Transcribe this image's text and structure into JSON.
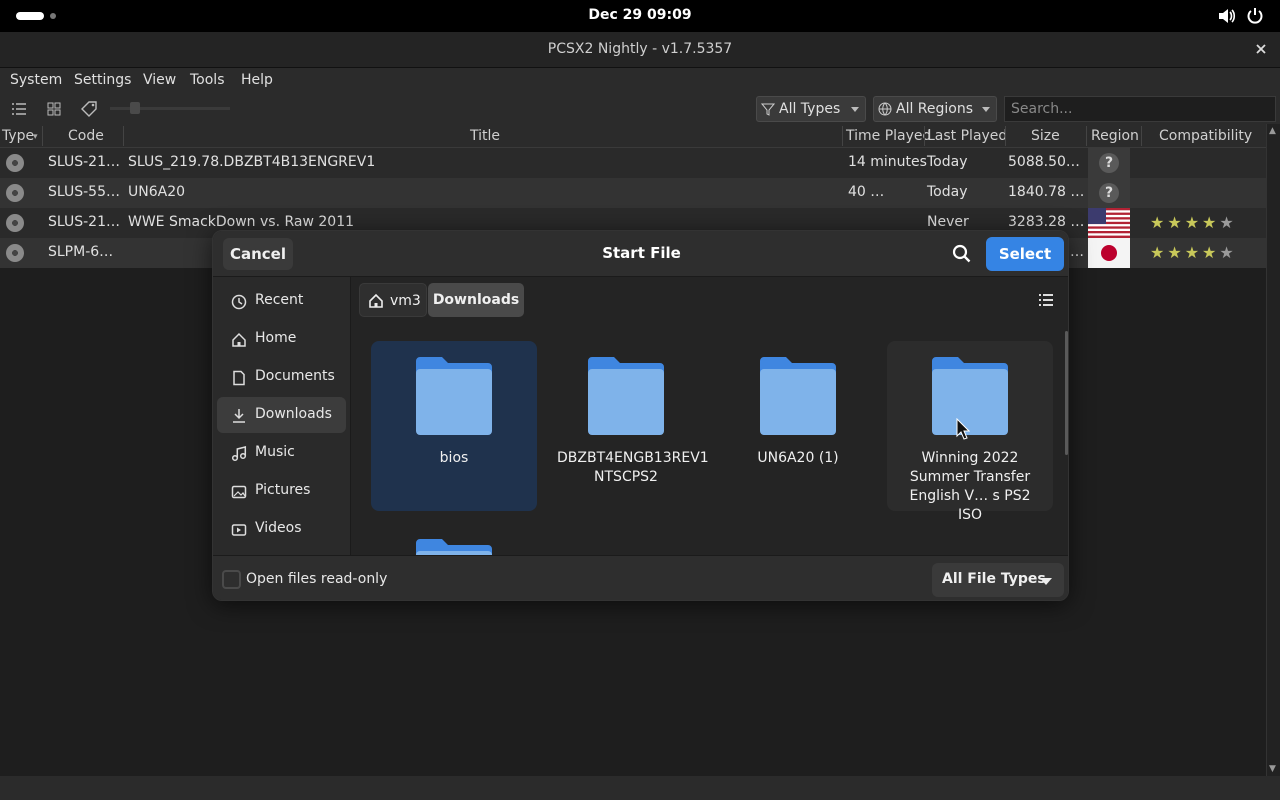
{
  "topbar": {
    "clock": "Dec 29  09:09",
    "icons": [
      "activities-pill",
      "volume-icon",
      "power-icon"
    ]
  },
  "window": {
    "title": "PCSX2 Nightly - v1.7.5357"
  },
  "menu": [
    "System",
    "Settings",
    "View",
    "Tools",
    "Help"
  ],
  "toolbar": {
    "type_filter": "All Types",
    "region_filter": "All Regions",
    "search_placeholder": "Search..."
  },
  "table": {
    "columns": [
      "Type",
      "Code",
      "Title",
      "Time Played",
      "Last Played",
      "Size",
      "Region",
      "Compatibility"
    ],
    "rows": [
      {
        "code": "SLUS-21…",
        "title": "SLUS_219.78.DBZBT4B13ENGREV1",
        "time_played": "14 minutes",
        "last_played": "Today",
        "size": "5088.50…",
        "region": "unknown",
        "stars": 0
      },
      {
        "code": "SLUS-55…",
        "title": "UN6A20",
        "time_played": "40 …",
        "last_played": "Today",
        "size": "1840.78 …",
        "region": "unknown",
        "stars": 0
      },
      {
        "code": "SLUS-21…",
        "title": "WWE SmackDown vs. Raw 2011",
        "time_played": "",
        "last_played": "Never",
        "size": "3283.28 …",
        "region": "usa",
        "stars": 4
      },
      {
        "code": "SLPM-6…",
        "title": "",
        "time_played": "",
        "last_played": "",
        "size": "…",
        "region": "japan",
        "stars": 4
      }
    ]
  },
  "dialog": {
    "title": "Start File",
    "cancel_label": "Cancel",
    "select_label": "Select",
    "sidebar": [
      {
        "label": "Recent",
        "icon": "clock-icon"
      },
      {
        "label": "Home",
        "icon": "home-icon"
      },
      {
        "label": "Documents",
        "icon": "document-icon"
      },
      {
        "label": "Downloads",
        "icon": "download-icon",
        "active": true
      },
      {
        "label": "Music",
        "icon": "music-icon"
      },
      {
        "label": "Pictures",
        "icon": "picture-icon"
      },
      {
        "label": "Videos",
        "icon": "video-icon"
      }
    ],
    "path": {
      "home": "vm3",
      "current": "Downloads"
    },
    "items": [
      {
        "name": "bios",
        "selected": true
      },
      {
        "name": "DBZBT4ENGB13REV1 NTSCPS2"
      },
      {
        "name": "UN6A20 (1)"
      },
      {
        "name": "Winning 2022 Summer Transfer English V… s PS2 ISO",
        "hovered": true
      }
    ],
    "read_only_label": "Open files read-only",
    "read_only_checked": false,
    "file_type": "All File Types"
  },
  "colors": {
    "accent": "#3584e4",
    "folder": "#7fb3ea",
    "folder_tab": "#3f86e0",
    "star": "#c8c85a"
  }
}
